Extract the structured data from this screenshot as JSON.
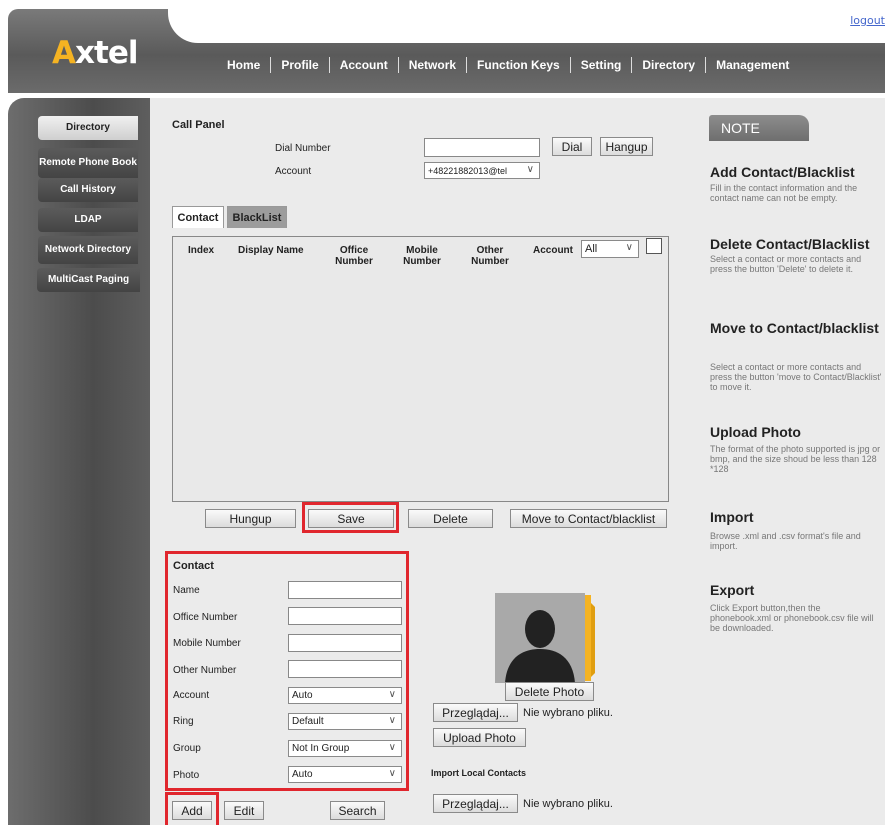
{
  "header": {
    "logo_prefix": "A",
    "logo_rest": "xtel",
    "logout": "logout",
    "nav": [
      "Home",
      "Profile",
      "Account",
      "Network",
      "Function Keys",
      "Setting",
      "Directory",
      "Management"
    ],
    "active_nav": "Directory"
  },
  "sidebar": {
    "items": [
      {
        "label": "Directory"
      },
      {
        "label": "Remote Phone Book"
      },
      {
        "label": "Call History"
      },
      {
        "label": "LDAP"
      },
      {
        "label": "Network Directory"
      },
      {
        "label": "MultiCast Paging"
      }
    ],
    "active": "Directory"
  },
  "call_panel": {
    "title": "Call Panel",
    "dial_number_label": "Dial Number",
    "dial_number_value": "",
    "dial_button": "Dial",
    "hangup_button": "Hangup",
    "account_label": "Account",
    "account_value": "+48221882013@tel"
  },
  "tabs": [
    "Contact",
    "BlackList"
  ],
  "table": {
    "headers": [
      "Index",
      "Display Name",
      "Office Number",
      "Mobile Number",
      "Other Number",
      "Account"
    ],
    "account_filter": "All",
    "rows": []
  },
  "table_buttons": [
    "Hungup",
    "Save",
    "Delete",
    "Move to Contact/blacklist"
  ],
  "contact_form": {
    "title": "Contact",
    "fields": [
      {
        "label": "Name",
        "value": ""
      },
      {
        "label": "Office Number",
        "value": ""
      },
      {
        "label": "Mobile Number",
        "value": ""
      },
      {
        "label": "Other Number",
        "value": ""
      }
    ],
    "selects": [
      {
        "label": "Account",
        "value": "Auto"
      },
      {
        "label": "Ring",
        "value": "Default"
      },
      {
        "label": "Group",
        "value": "Not In Group"
      },
      {
        "label": "Photo",
        "value": "Auto"
      }
    ],
    "buttons": [
      "Add",
      "Edit",
      "Search"
    ]
  },
  "photo": {
    "delete_button": "Delete Photo",
    "browse_button": "Przeglądaj...",
    "no_file": "Nie wybrano pliku.",
    "upload_button": "Upload Photo",
    "import_title": "Import Local Contacts",
    "import_browse": "Przeglądaj...",
    "import_no_file": "Nie wybrano pliku."
  },
  "note": {
    "tab": "NOTE",
    "sections": [
      {
        "title": "Add Contact/Blacklist",
        "text": "Fill in the contact information and the contact name can not be empty."
      },
      {
        "title": "Delete Contact/Blacklist",
        "text": "Select a contact or more contacts and press the button 'Delete' to delete it."
      },
      {
        "title": "Move to Contact/blacklist",
        "text": "Select a contact or more contacts and press the button 'move to Contact/Blacklist' to move it."
      },
      {
        "title": "Upload Photo",
        "text": "The format of the photo supported is jpg or bmp, and the size shoud be less than 128 *128"
      },
      {
        "title": "Import",
        "text": "Browse .xml and .csv format's file and import."
      },
      {
        "title": "Export",
        "text": "Click Export button,then the phonebook.xml or phonebook.csv file will be downloaded."
      }
    ]
  },
  "colors": {
    "highlight": "#e0262d",
    "logo_accent": "#f5b322",
    "link": "#4466cc"
  }
}
